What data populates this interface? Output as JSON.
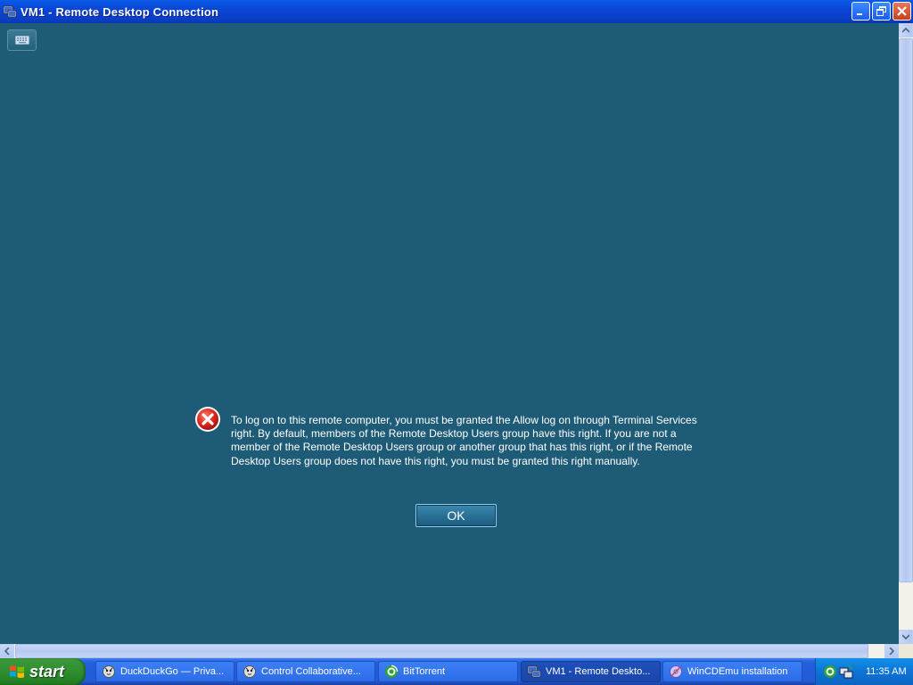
{
  "window": {
    "title": "VM1 - Remote Desktop Connection"
  },
  "dialog": {
    "message": "To log on to this remote computer, you must be granted the Allow log on through Terminal Services right. By default, members of the Remote Desktop Users group have this right. If you are not a member of the Remote Desktop Users group or another group that has this right, or if the Remote Desktop Users group does not have this right, you must be granted this right manually.",
    "ok_label": "OK",
    "icon": "error-icon"
  },
  "taskbar": {
    "start_label": "start",
    "tasks": [
      {
        "label": "DuckDuckGo — Priva...",
        "icon": "duckduckgo-icon"
      },
      {
        "label": "Control Collaborative...",
        "icon": "duckduckgo-icon"
      },
      {
        "label": "BitTorrent",
        "icon": "bittorrent-icon"
      },
      {
        "label": "VM1 - Remote Deskto...",
        "icon": "remote-desktop-icon"
      },
      {
        "label": "WinCDEmu installation",
        "icon": "installer-icon"
      }
    ],
    "clock": "11:35 AM"
  },
  "colors": {
    "remote_background": "#1e5b76",
    "titlebar": "#0a46d6",
    "taskbar": "#245edb",
    "start": "#2f8e2f"
  }
}
